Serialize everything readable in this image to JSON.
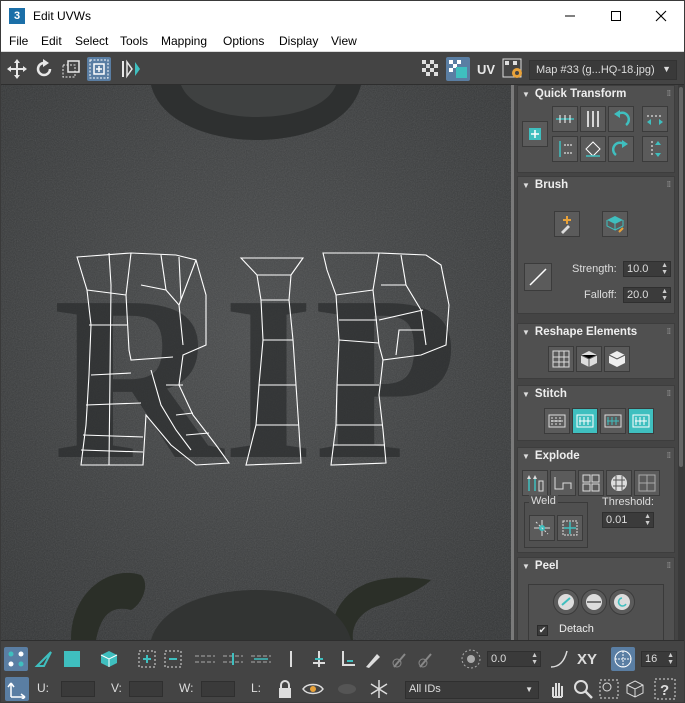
{
  "window": {
    "title": "Edit UVWs",
    "app_icon": "3"
  },
  "menu": [
    "File",
    "Edit",
    "Select",
    "Tools",
    "Mapping",
    "Options",
    "Display",
    "View"
  ],
  "toolbar": {
    "uv_label": "UV",
    "map_select": "Map #33 (g...HQ-18.jpg)"
  },
  "viewport": {
    "letters": "RIP"
  },
  "panel": {
    "quick_transform": {
      "title": "Quick Transform"
    },
    "brush": {
      "title": "Brush",
      "strength_label": "Strength:",
      "strength": "10.0",
      "falloff_label": "Falloff:",
      "falloff": "20.0"
    },
    "reshape": {
      "title": "Reshape Elements"
    },
    "stitch": {
      "title": "Stitch"
    },
    "explode": {
      "title": "Explode",
      "weld_label": "Weld",
      "threshold_label": "Threshold:",
      "threshold": "0.01"
    },
    "peel": {
      "title": "Peel",
      "detach_label": "Detach",
      "detach_checked": true
    }
  },
  "bottom": {
    "offset_value": "0.0",
    "xy_label": "XY",
    "zoom_value": "16",
    "u_label": "U:",
    "v_label": "V:",
    "w_label": "W:",
    "l_label": "L:",
    "u_value": "",
    "v_value": "",
    "w_value": "",
    "ids_select": "All IDs"
  },
  "colors": {
    "accent": "#3fbfbf",
    "active_blue": "#5a7ea3",
    "panel_bg": "#444444"
  }
}
